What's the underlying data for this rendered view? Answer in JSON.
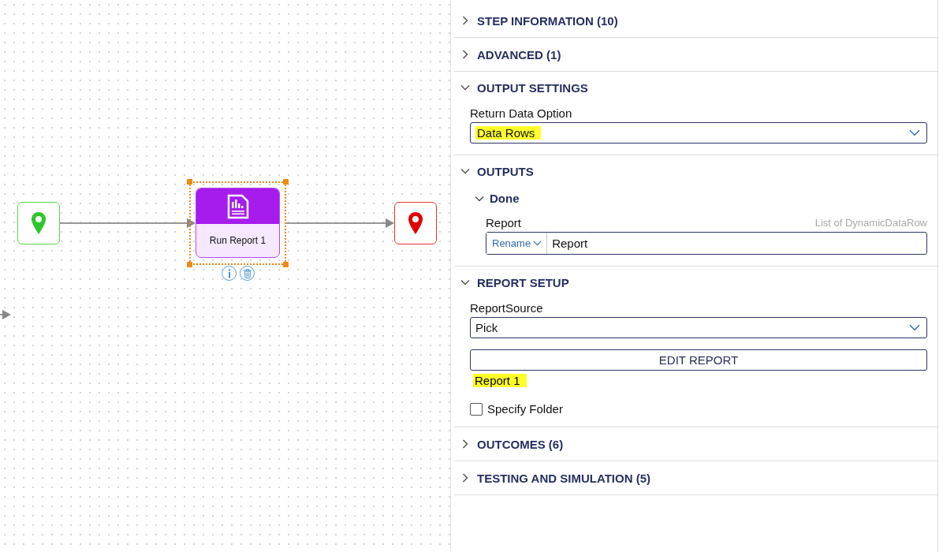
{
  "canvas": {
    "nodes": [
      {
        "kind": "start"
      },
      {
        "kind": "step",
        "label": "Run Report 1",
        "selected": true
      },
      {
        "kind": "end"
      }
    ]
  },
  "panel": {
    "sections": [
      {
        "kind": "plain",
        "title": "STEP INFORMATION (10)",
        "expanded": false
      },
      {
        "kind": "plain",
        "title": "ADVANCED (1)",
        "expanded": false
      },
      {
        "kind": "select_field",
        "title": "OUTPUT SETTINGS",
        "expanded": true,
        "label": "Return Data Option",
        "value": "Data Rows",
        "highlighted": true
      },
      {
        "kind": "outputs",
        "title": "OUTPUTS",
        "expanded": true,
        "group": {
          "title": "Done",
          "expanded": true,
          "output": {
            "label": "Report",
            "type": "List of DynamicDataRow",
            "mode": "Rename",
            "value": "Report"
          }
        }
      },
      {
        "kind": "report_setup",
        "title": "REPORT SETUP",
        "expanded": true,
        "label": "ReportSource",
        "value": "Pick",
        "button": "EDIT REPORT",
        "report": "Report 1",
        "report_highlighted": true,
        "checkbox": {
          "label": "Specify Folder",
          "checked": false
        }
      },
      {
        "kind": "plain",
        "title": "OUTCOMES (6)",
        "expanded": false
      },
      {
        "kind": "plain",
        "title": "TESTING AND SIMULATION (5)",
        "expanded": false
      }
    ]
  }
}
